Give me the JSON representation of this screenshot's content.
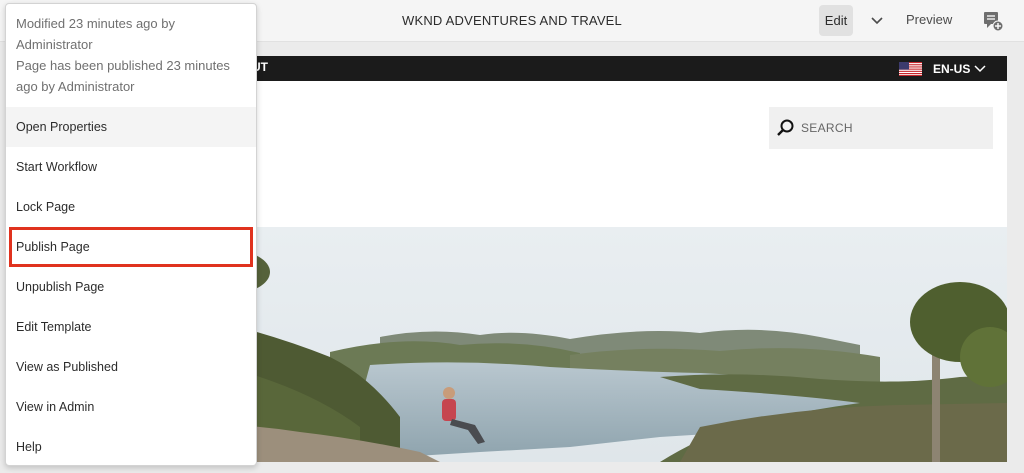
{
  "header": {
    "title": "WKND ADVENTURES AND TRAVEL",
    "edit_label": "Edit",
    "preview_label": "Preview"
  },
  "page": {
    "nav_partial": "UT",
    "language": "EN-US",
    "search_placeholder": "SEARCH"
  },
  "menu": {
    "status_lines": [
      "Modified 23 minutes ago by",
      "Administrator",
      "Page has been published 23 minutes",
      "ago by Administrator"
    ],
    "items": [
      {
        "label": "Open Properties"
      },
      {
        "label": "Start Workflow"
      },
      {
        "label": "Lock Page"
      },
      {
        "label": "Publish Page"
      },
      {
        "label": "Unpublish Page"
      },
      {
        "label": "Edit Template"
      },
      {
        "label": "View as Published"
      },
      {
        "label": "View in Admin"
      },
      {
        "label": "Help"
      }
    ]
  },
  "colors": {
    "highlight": "#e0321e",
    "topbar": "#f5f5f5",
    "nav_bar": "#1b1b1b"
  }
}
